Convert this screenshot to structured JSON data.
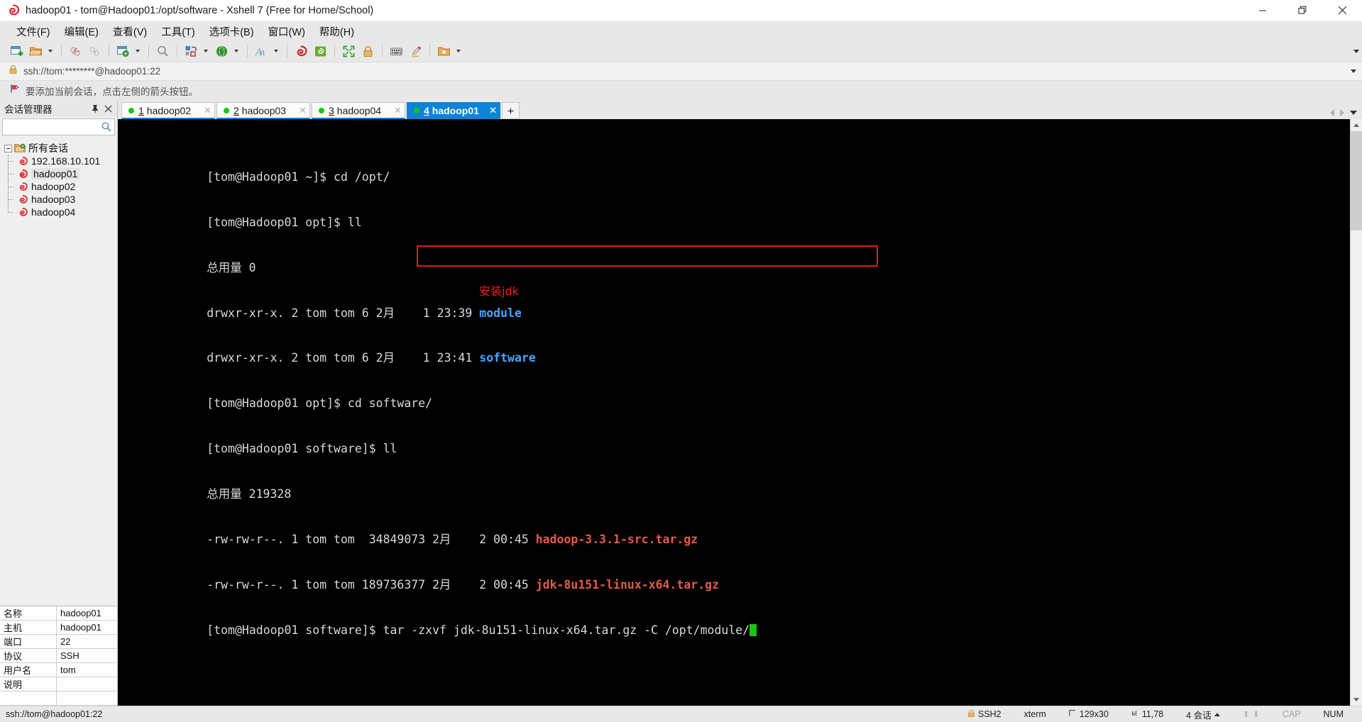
{
  "window": {
    "title": "hadoop01 - tom@Hadoop01:/opt/software - Xshell 7 (Free for Home/School)",
    "app_icon": "xshell-logo-icon",
    "minimize_label": "—",
    "restore_label": "restore-icon",
    "close_label": "✕"
  },
  "menubar": {
    "items": [
      {
        "label": "文件(F)",
        "name": "menu-file"
      },
      {
        "label": "编辑(E)",
        "name": "menu-edit"
      },
      {
        "label": "查看(V)",
        "name": "menu-view"
      },
      {
        "label": "工具(T)",
        "name": "menu-tools"
      },
      {
        "label": "选项卡(B)",
        "name": "menu-tab"
      },
      {
        "label": "窗口(W)",
        "name": "menu-window"
      },
      {
        "label": "帮助(H)",
        "name": "menu-help"
      }
    ]
  },
  "toolbar": {
    "buttons": [
      "new-session-icon",
      "open-folder-icon",
      "disconnect-icon",
      "link-icon",
      "session-properties-icon",
      "find-icon",
      "transfer-icon",
      "globe-icon",
      "font-icon",
      "xshell-icon",
      "xftp-icon",
      "fullscreen-icon",
      "lock-icon",
      "keyboard-icon",
      "highlight-pen-icon",
      "add-folder-icon"
    ],
    "overflow_label": "toolbar-overflow"
  },
  "address": {
    "lock_icon": "lock-icon",
    "value": "ssh://tom:********@hadoop01:22",
    "dropdown_icon": "chevron-down-icon"
  },
  "tip": {
    "icon": "red-flag-icon",
    "text": "要添加当前会话，点击左侧的箭头按钮。"
  },
  "sidebar": {
    "title": "会话管理器",
    "pin_label": "📌",
    "close_label": "✕",
    "search_placeholder": "",
    "search_value": "",
    "search_icon": "search-icon",
    "root": {
      "label": "所有会话",
      "icon": "folder-sessions-icon"
    },
    "sessions": [
      {
        "label": "192.168.10.101",
        "icon": "xshell-session-icon",
        "selected": false
      },
      {
        "label": "hadoop01",
        "icon": "xshell-session-icon",
        "selected": true
      },
      {
        "label": "hadoop02",
        "icon": "xshell-session-icon",
        "selected": false
      },
      {
        "label": "hadoop03",
        "icon": "xshell-session-icon",
        "selected": false
      },
      {
        "label": "hadoop04",
        "icon": "xshell-session-icon",
        "selected": false
      }
    ],
    "properties": [
      {
        "key": "名称",
        "value": "hadoop01"
      },
      {
        "key": "主机",
        "value": "hadoop01"
      },
      {
        "key": "端口",
        "value": "22"
      },
      {
        "key": "协议",
        "value": "SSH"
      },
      {
        "key": "用户名",
        "value": "tom"
      },
      {
        "key": "说明",
        "value": ""
      },
      {
        "key": "",
        "value": ""
      }
    ]
  },
  "tabs": {
    "items": [
      {
        "num": "1",
        "label": "hadoop02",
        "active": false,
        "status": "connected"
      },
      {
        "num": "2",
        "label": "hadoop03",
        "active": false,
        "status": "connected"
      },
      {
        "num": "3",
        "label": "hadoop04",
        "active": false,
        "status": "connected"
      },
      {
        "num": "4",
        "label": "hadoop01",
        "active": true,
        "status": "connected"
      }
    ],
    "new_tab_label": "+",
    "close_label": "✕"
  },
  "terminal": {
    "lines": [
      [
        {
          "t": "[tom@Hadoop01 ~]$ cd /opt/",
          "c": "white"
        }
      ],
      [
        {
          "t": "[tom@Hadoop01 opt]$ ll",
          "c": "white"
        }
      ],
      [
        {
          "t": "总用量 0",
          "c": "white"
        }
      ],
      [
        {
          "t": "drwxr-xr-x. 2 tom tom 6 2月    1 23:39 ",
          "c": "white"
        },
        {
          "t": "module",
          "c": "blue"
        }
      ],
      [
        {
          "t": "drwxr-xr-x. 2 tom tom 6 2月    1 23:41 ",
          "c": "white"
        },
        {
          "t": "software",
          "c": "blue"
        }
      ],
      [
        {
          "t": "[tom@Hadoop01 opt]$ cd software/",
          "c": "white"
        }
      ],
      [
        {
          "t": "[tom@Hadoop01 software]$ ll",
          "c": "white"
        }
      ],
      [
        {
          "t": "总用量 219328",
          "c": "white"
        }
      ],
      [
        {
          "t": "-rw-rw-r--. 1 tom tom  34849073 2月    2 00:45 ",
          "c": "white"
        },
        {
          "t": "hadoop-3.3.1-src.tar.gz",
          "c": "red"
        }
      ],
      [
        {
          "t": "-rw-rw-r--. 1 tom tom 189736377 2月    2 00:45 ",
          "c": "white"
        },
        {
          "t": "jdk-8u151-linux-x64.tar.gz",
          "c": "red"
        }
      ],
      [
        {
          "t": "[tom@Hadoop01 software]$ tar -zxvf jdk-8u151-linux-x64.tar.gz -C /opt/module/",
          "c": "white",
          "cursor": true
        }
      ]
    ],
    "annotation": "安装jdk",
    "highlight_color": "#e01b1b",
    "annotation_color": "#ee1c1c"
  },
  "statusbar": {
    "connection": "ssh://tom@hadoop01:22",
    "protocol": "SSH2",
    "protocol_icon": "lock-icon",
    "terminal_type": "xterm",
    "size_icon": "size-icon",
    "size": "129x30",
    "cursor_icon": "cursor-icon",
    "cursor_pos": "11,78",
    "sessions": "4 会话",
    "sessions_caret": "caret-up-icon",
    "transfer_up_icon": "arrow-up-icon",
    "transfer_down_icon": "arrow-down-icon",
    "cap": "CAP",
    "num": "NUM"
  }
}
